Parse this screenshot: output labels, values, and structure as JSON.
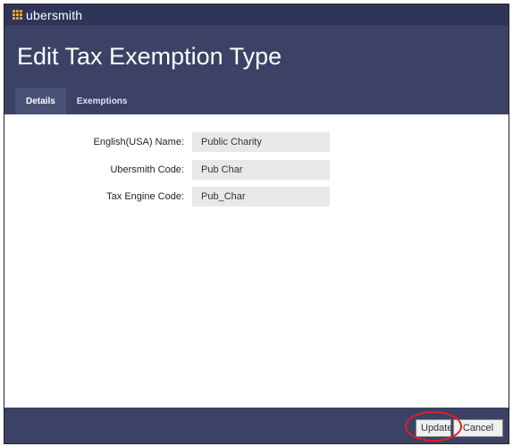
{
  "brand": {
    "name": "ubersmith",
    "accent": "#e8a21a"
  },
  "page": {
    "title": "Edit Tax Exemption Type"
  },
  "tabs": [
    {
      "label": "Details",
      "active": true
    },
    {
      "label": "Exemptions",
      "active": false
    }
  ],
  "form": {
    "fields": [
      {
        "label": "English(USA) Name:",
        "value": "Public Charity"
      },
      {
        "label": "Ubersmith Code:",
        "value": "Pub Char"
      },
      {
        "label": "Tax Engine Code:",
        "value": "Pub_Char"
      }
    ]
  },
  "footer": {
    "update_label": "Update",
    "cancel_label": "Cancel"
  },
  "colors": {
    "header_bg": "#3b4266",
    "brandbar_bg": "#2f3558",
    "highlight": "#e0201d"
  }
}
